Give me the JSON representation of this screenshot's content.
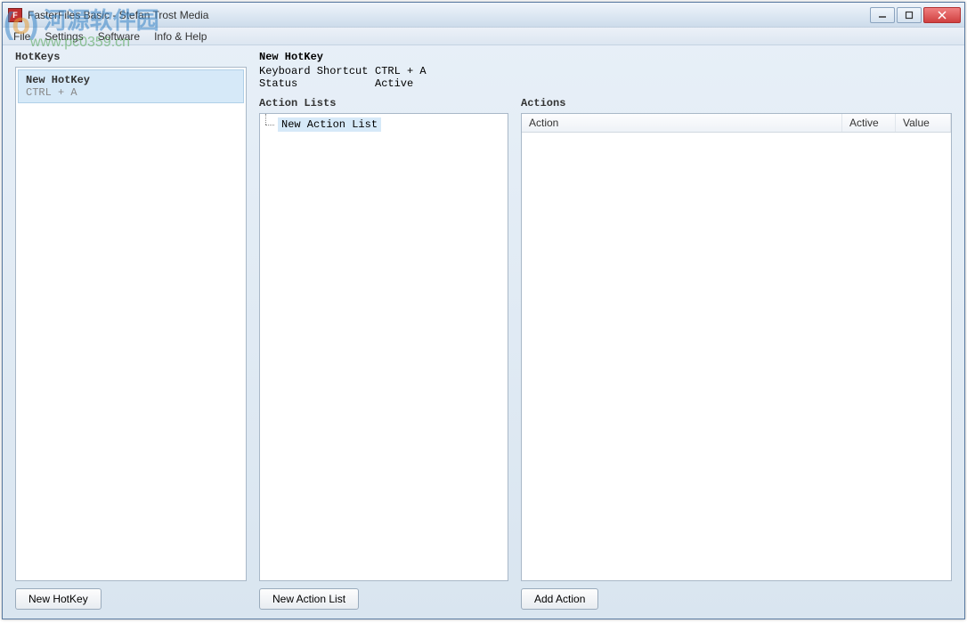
{
  "window": {
    "title": "FasterFiles Basic - Stefan Trost Media"
  },
  "menubar": {
    "file": "File",
    "settings": "Settings",
    "software": "Software",
    "info_help": "Info & Help"
  },
  "watermark": {
    "brand_cn": "河源软件园",
    "url": "www.pc0359.cn"
  },
  "left": {
    "heading": "HotKeys",
    "item": {
      "name": "New HotKey",
      "shortcut": "CTRL + A"
    },
    "new_button": "New HotKey"
  },
  "mid": {
    "details": {
      "name": "New HotKey",
      "shortcut_label": "Keyboard Shortcut",
      "shortcut_value": "CTRL + A",
      "status_label": "Status",
      "status_value": "Active"
    },
    "heading": "Action Lists",
    "tree_item": "New Action List",
    "new_button": "New Action List"
  },
  "right": {
    "heading": "Actions",
    "columns": {
      "action": "Action",
      "active": "Active",
      "value": "Value"
    },
    "add_button": "Add Action"
  }
}
